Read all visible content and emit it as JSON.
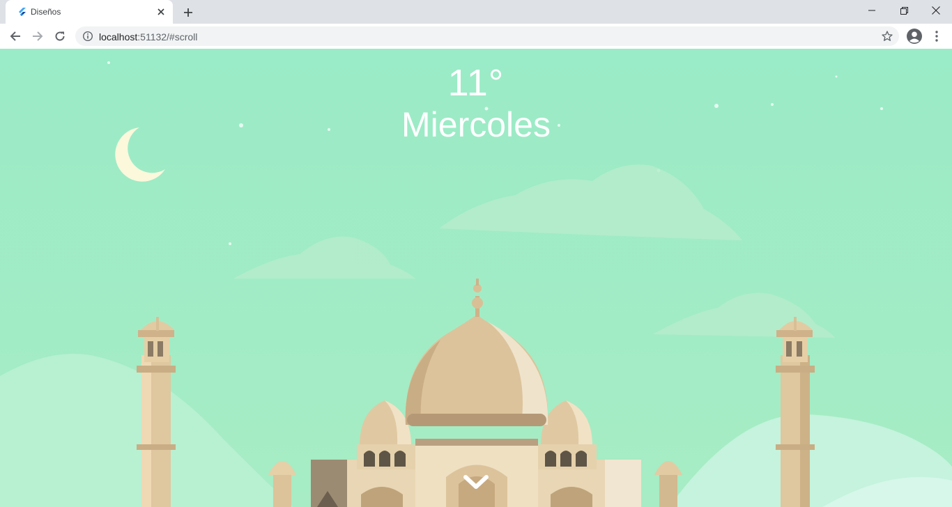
{
  "browser": {
    "tab_title": "Diseños",
    "url_host": "localhost",
    "url_path": ":51132/#scroll",
    "new_tab_label": "+"
  },
  "page": {
    "temperature": "11°",
    "day": "Miercoles"
  },
  "colors": {
    "sky": "#9debc6",
    "moon": "#fbf8dc",
    "text": "#ffffff"
  },
  "icons": {
    "favicon": "flutter-icon",
    "back": "back-arrow-icon",
    "forward": "forward-arrow-icon",
    "reload": "reload-icon",
    "info": "info-icon",
    "star": "star-icon",
    "profile": "profile-icon",
    "menu": "kebab-menu-icon",
    "scroll": "chevron-down-icon"
  }
}
